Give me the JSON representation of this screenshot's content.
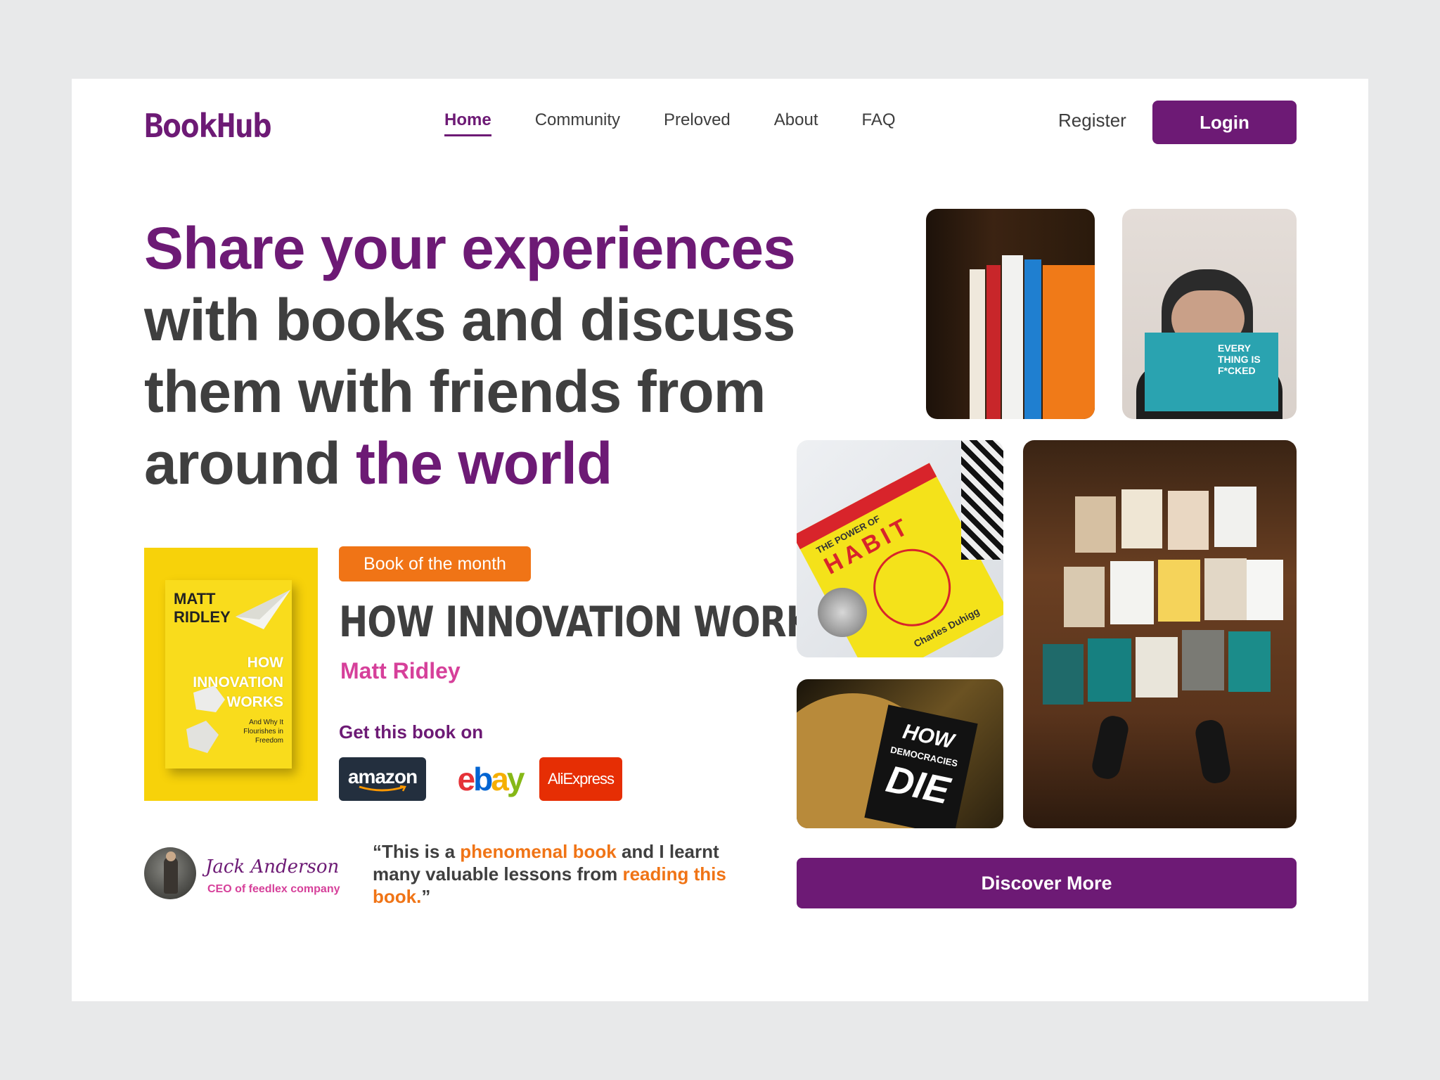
{
  "brand": {
    "logo": "BookHub",
    "accent": "#6d1a75",
    "highlight": "#f07416",
    "pink": "#d6409a"
  },
  "nav": {
    "items": [
      "Home",
      "Community",
      "Preloved",
      "About",
      "FAQ"
    ],
    "active": "Home",
    "register": "Register",
    "login": "Login"
  },
  "hero": {
    "line1": "Share your experiences",
    "line2": "with books and discuss",
    "line3": "them with friends from",
    "line4_plain": "around ",
    "line4_accent": "the world"
  },
  "featured": {
    "badge": "Book of the month",
    "title": "HOW INNOVATION WORKS",
    "author": "Matt Ridley",
    "cover_author_line1": "MATT",
    "cover_author_line2": "RIDLEY",
    "cover_title_1": "HOW",
    "cover_title_2": "INNOVATION",
    "cover_title_3": "WORKS",
    "cover_subtitle": "And Why It Flourishes in Freedom",
    "get_label": "Get this book on",
    "stores": {
      "amazon": "amazon",
      "ebay": "ebay",
      "aliexpress": "AliExpress"
    }
  },
  "testimonial": {
    "name": "Jack Anderson",
    "role": "CEO of feedlex company",
    "quote_1": "“This is a ",
    "quote_hl1": "phenomenal book",
    "quote_2": " and I learnt many valuable lessons from ",
    "quote_hl2": "reading this book.",
    "quote_3": "”"
  },
  "gallery": {
    "cta": "Discover More",
    "book_habit_line1": "THE POWER OF",
    "book_habit_line2": "HABIT",
    "book_habit_author": "Charles Duhigg",
    "book_manson": "EVERY THING IS F*CKED",
    "book_democracy_1": "HOW",
    "book_democracy_2": "DEMOCRACIES",
    "book_democracy_3": "DIE"
  }
}
